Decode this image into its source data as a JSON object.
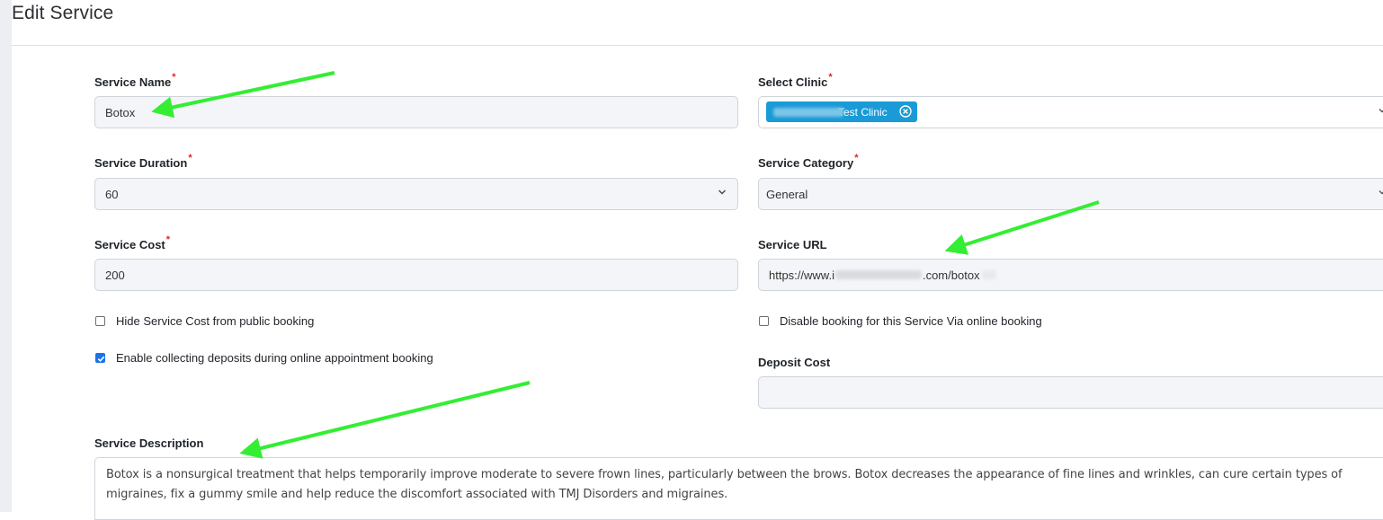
{
  "page": {
    "title": "Edit Service"
  },
  "form": {
    "service_name": {
      "label": "Service Name",
      "required": "*",
      "value": "Botox"
    },
    "select_clinic": {
      "label": "Select Clinic",
      "required": "*",
      "tag_text": "Test Clinic"
    },
    "service_duration": {
      "label": "Service Duration",
      "required": "*",
      "value": "60"
    },
    "service_category": {
      "label": "Service Category",
      "required": "*",
      "value": "General"
    },
    "service_cost": {
      "label": "Service Cost",
      "required": "*",
      "value": "200"
    },
    "service_url": {
      "label": "Service URL",
      "value_prefix": "https://www.i",
      "value_suffix": ".com/botox"
    },
    "hide_cost": {
      "label": "Hide Service Cost from public booking",
      "checked": false
    },
    "disable_booking": {
      "label": "Disable booking for this Service Via online booking",
      "checked": false
    },
    "enable_deposits": {
      "label": "Enable collecting deposits during online appointment booking",
      "checked": true
    },
    "deposit_cost": {
      "label": "Deposit Cost",
      "value": ""
    },
    "service_description": {
      "label": "Service Description",
      "value": "Botox is a nonsurgical treatment that helps temporarily improve moderate to severe frown lines, particularly between the brows. Botox decreases the appearance of fine lines and wrinkles, can cure certain types of migraines, fix a gummy smile and help reduce the discomfort associated with TMJ Disorders and migraines."
    }
  },
  "colors": {
    "tag": "#1a9bd7",
    "required": "#e02424",
    "annotation_arrow": "#33ee33",
    "checkbox_checked": "#1a73e8"
  },
  "icons": {
    "dropdown": "chevron-down-icon",
    "tag_remove": "close-circle-icon",
    "checkbox_mark": "checkmark-icon"
  }
}
